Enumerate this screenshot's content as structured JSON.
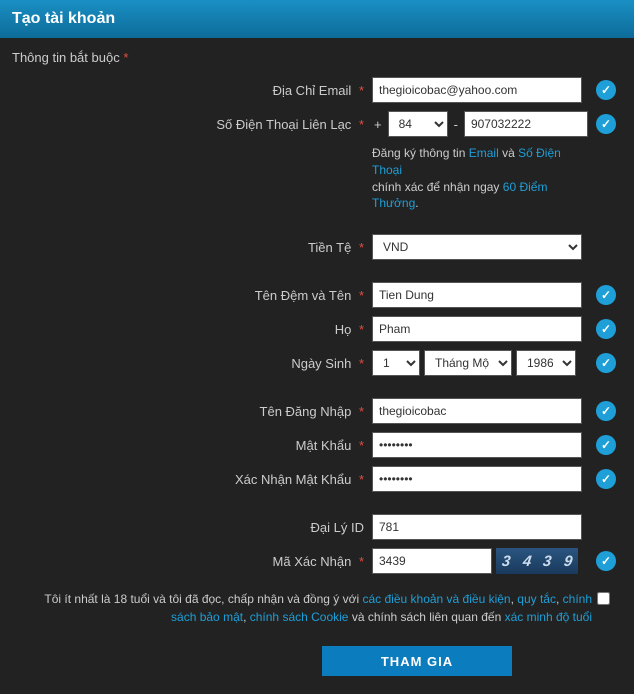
{
  "header": {
    "title": "Tạo tài khoản"
  },
  "subheader": {
    "text": "Thông tin bắt buộc",
    "req": "*"
  },
  "labels": {
    "email": "Địa Chỉ Email",
    "phone": "Số Điện Thoại Liên Lạc",
    "currency": "Tiền Tệ",
    "firstname": "Tên Đệm và Tên",
    "lastname": "Họ",
    "dob": "Ngày Sinh",
    "username": "Tên Đăng Nhập",
    "password": "Mật Khẩu",
    "confirm_password": "Xác Nhận Mật Khẩu",
    "agent_id": "Đại Lý ID",
    "captcha": "Mã Xác Nhận"
  },
  "values": {
    "email": "thegioicobac@yahoo.com",
    "country_code": "84",
    "phone": "907032222",
    "currency": "VND",
    "firstname": "Tien Dung",
    "lastname": "Pham",
    "day": "1",
    "month": "Tháng Một",
    "year": "1986",
    "username": "thegioicobac",
    "password": "••••••••",
    "confirm_password": "••••••••",
    "agent_id": "781",
    "captcha": "3439",
    "captcha_digits": [
      "3",
      "4",
      "3",
      "9"
    ]
  },
  "info": {
    "prefix": "Đăng ký thông tin ",
    "email_link": "Email",
    "mid": " và ",
    "phone_link": "Số Điện Thoại",
    "line2a": "chính xác để nhận ngay ",
    "points_link": "60 Điểm Thưởng",
    "dot": "."
  },
  "terms": {
    "t1": "Tôi ít nhất là 18 tuổi và tôi đã đọc, chấp nhận và đồng ý với ",
    "l1": "các điều khoản và điều kiện",
    "c1": ", ",
    "l2": "quy tắc",
    "c2": ", ",
    "l3": "chính sách bảo mật",
    "c3": ", ",
    "l4": "chính sách Cookie",
    "t2": " và chính sách liên quan đến ",
    "l5": "xác minh độ tuổi"
  },
  "submit": {
    "label": "THAM GIA"
  },
  "symbols": {
    "plus": "+",
    "dash": "-",
    "req": "*"
  }
}
